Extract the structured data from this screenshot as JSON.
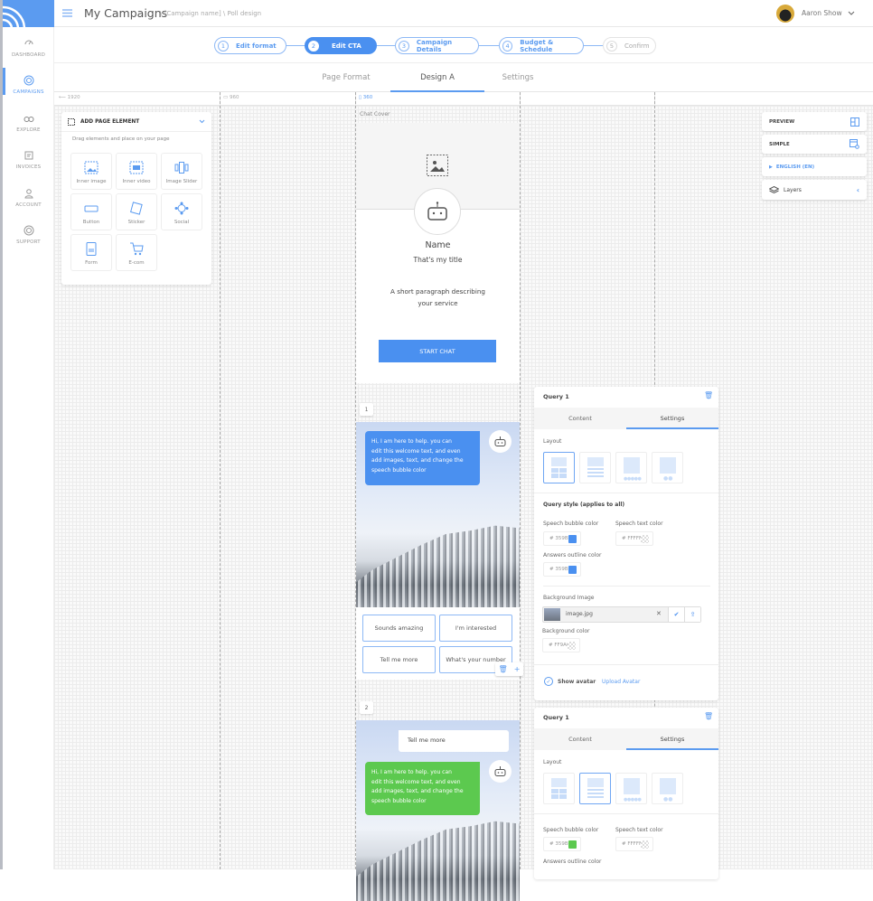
{
  "header": {
    "title": "My Campaigns",
    "breadcrumb": "\\ [Campaign name] \\ Poll design",
    "user_name": "Aaron Show"
  },
  "sidebar": {
    "items": [
      {
        "label": "DASHBOARD"
      },
      {
        "label": "CAMPAIGNS",
        "active": true
      },
      {
        "label": "EXPLORE"
      },
      {
        "label": "INVOICES"
      },
      {
        "label": "ACCOUNT"
      },
      {
        "label": "SUPPORT"
      }
    ]
  },
  "steps": [
    {
      "num": "1",
      "label": "Edit format"
    },
    {
      "num": "2",
      "label": "Edit CTA",
      "active": true
    },
    {
      "num": "3",
      "label": "Campaign Details"
    },
    {
      "num": "4",
      "label": "Budget & Schedule"
    },
    {
      "num": "5",
      "label": "Confirm",
      "disabled": true
    }
  ],
  "tabs": [
    {
      "label": "Page Format"
    },
    {
      "label": "Design A",
      "active": true
    },
    {
      "label": "Settings"
    }
  ],
  "ruler": {
    "w1": "1920",
    "w2": "960",
    "w3": "360"
  },
  "add_panel": {
    "title": "ADD PAGE ELEMENT",
    "hint": "Drag elements and place on your page",
    "elements": [
      "Inner image",
      "Inner video",
      "Image Slider",
      "Button",
      "Sticker",
      "Social",
      "Form",
      "E-com"
    ]
  },
  "cover": {
    "label": "Chat Cover",
    "name": "Name",
    "title": "That's my title",
    "paragraph_1": "A short paragraph describing",
    "paragraph_2": "your service",
    "button": "START CHAT"
  },
  "queries": [
    {
      "number": "1",
      "bubble_lines": [
        "Hi, I am here to help. you can",
        "edit this welcome text, and even",
        "add images, text, and change the",
        "speech bubble color"
      ],
      "bubble_color": "#4a90f0",
      "answers": [
        "Sounds amazing",
        "I'm interested",
        "Tell me more",
        "What's your number"
      ]
    },
    {
      "number": "2",
      "user_reply": "Tell me more",
      "bubble_lines": [
        "Hi, I am here to help. you can",
        "edit this welcome text, and even",
        "add images, text, and change the",
        "speech bubble color"
      ],
      "bubble_color": "#5cc94f"
    }
  ],
  "right_panel": {
    "preview": "PREVIEW",
    "simple": "SIMPLE",
    "language": "ENGLISH (EN)",
    "layers": "Layers"
  },
  "query_panels": [
    {
      "title": "Query 1",
      "tab_content": "Content",
      "tab_settings": "Settings",
      "layout_label": "Layout",
      "selected_layout": 1,
      "style_title": "Query style (applies to all)",
      "speech_bubble_label": "Speech bubble color",
      "speech_bubble_value": "# 359BFF",
      "speech_text_label": "Speech text color",
      "speech_text_value": "# FFFFFF",
      "answers_outline_label": "Answers outline color",
      "answers_outline_value": "# 359BFF",
      "bg_image_label": "Background Image",
      "bg_image_file": "image.jpg",
      "bg_color_label": "Background color",
      "bg_color_value": "# FF9A00",
      "show_avatar": "Show avatar",
      "upload_avatar": "Upload Avatar"
    },
    {
      "title": "Query 1",
      "tab_content": "Content",
      "tab_settings": "Settings",
      "layout_label": "Layout",
      "selected_layout": 2,
      "speech_bubble_label": "Speech bubble color",
      "speech_bubble_value": "# 359BFF",
      "speech_text_label": "Speech text color",
      "speech_text_value": "# FFFFFF",
      "answers_outline_label": "Answers outline color"
    }
  ],
  "colors": {
    "accent": "#4a90f0",
    "green": "#5cc94f"
  }
}
